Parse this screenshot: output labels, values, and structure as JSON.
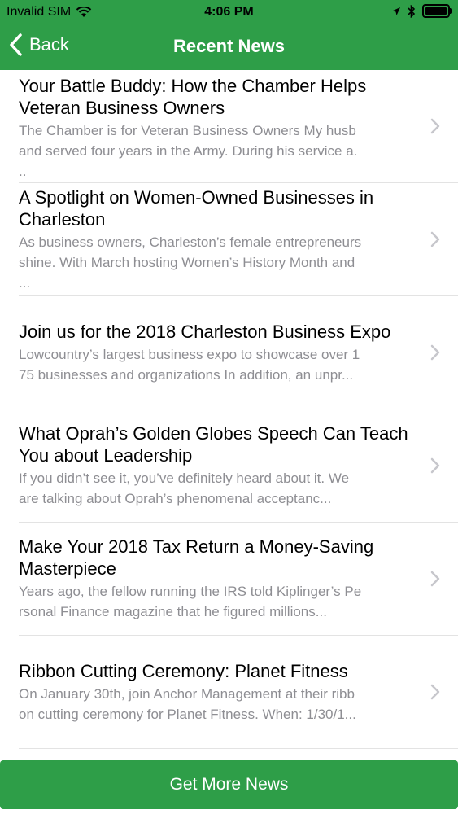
{
  "status_bar": {
    "carrier": "Invalid SIM",
    "time": "4:06 PM"
  },
  "nav": {
    "back_label": "Back",
    "title": "Recent News"
  },
  "articles": [
    {
      "title": "Your Battle Buddy: How the Chamber Helps Veteran Business Owners",
      "desc": "The Chamber is for Veteran Business Owners My husb\nand served four years in the Army. During his service a.\n.."
    },
    {
      "title": "A Spotlight on Women-Owned Businesses in Charleston",
      "desc": "As business owners, Charleston’s female entrepreneurs\nshine. With March hosting Women’s History Month and\n..."
    },
    {
      "title": "Join us for the 2018 Charleston Business Expo",
      "desc": "Lowcountry’s largest business expo to showcase over 1\n75 businesses and organizations In addition, an unpr..."
    },
    {
      "title": "What Oprah’s Golden Globes Speech Can Teach You about Leadership",
      "desc": "If you didn’t see it, you’ve definitely heard about it. We\nare talking about Oprah’s phenomenal acceptanc..."
    },
    {
      "title": "Make Your 2018 Tax Return a Money-Saving Masterpiece",
      "desc": "Years ago, the fellow running the IRS told Kiplinger’s Pe\nrsonal Finance magazine that he figured millions..."
    },
    {
      "title": "Ribbon Cutting Ceremony: Planet Fitness",
      "desc": "On January 30th, join Anchor Management at their ribb\non cutting ceremony for Planet Fitness. When: 1/30/1..."
    }
  ],
  "footer": {
    "button_label": "Get More News"
  },
  "colors": {
    "brand_green": "#2e9e48",
    "chevron": "#c7c7cc",
    "secondary_text": "#8e8e93"
  }
}
